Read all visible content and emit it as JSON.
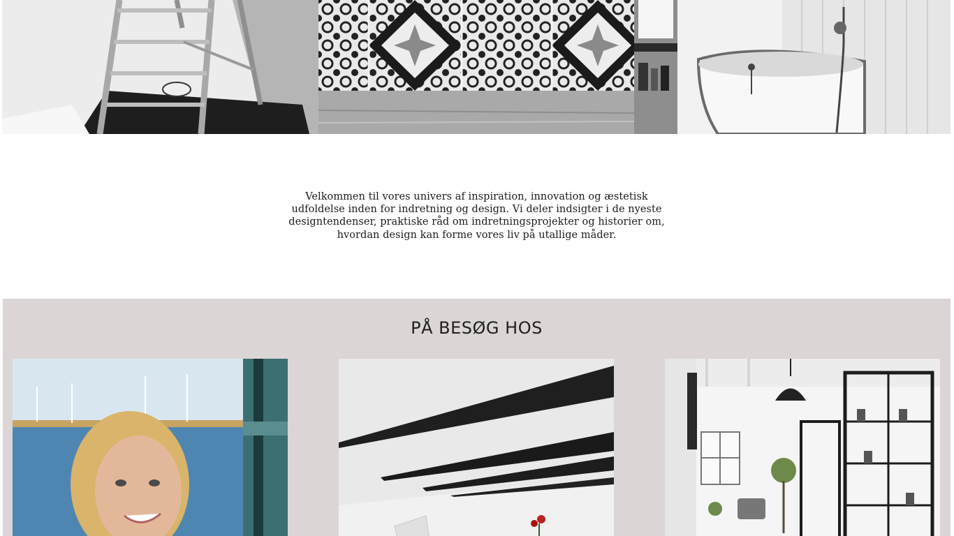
{
  "hero": {
    "images": [
      {
        "icon": "ladder-photo"
      },
      {
        "icon": "patterned-tiles-photo"
      },
      {
        "icon": "bathtub-photo"
      }
    ]
  },
  "intro": {
    "text": "Velkommen til vores univers af inspiration, innovation og æstetisk udfoldelse inden for indretning og design. Vi deler indsigter i de nyeste designtendenser, praktiske råd om indretningsprojekter og historier om, hvordan design kan forme vores liv på utallige måder."
  },
  "visit": {
    "title": "PÅ BESØG HOS",
    "background_color": "#dbd5d5",
    "cards": [
      {
        "icon": "woman-portrait-photo"
      },
      {
        "icon": "attic-room-photo"
      },
      {
        "icon": "showroom-interior-photo"
      }
    ]
  }
}
